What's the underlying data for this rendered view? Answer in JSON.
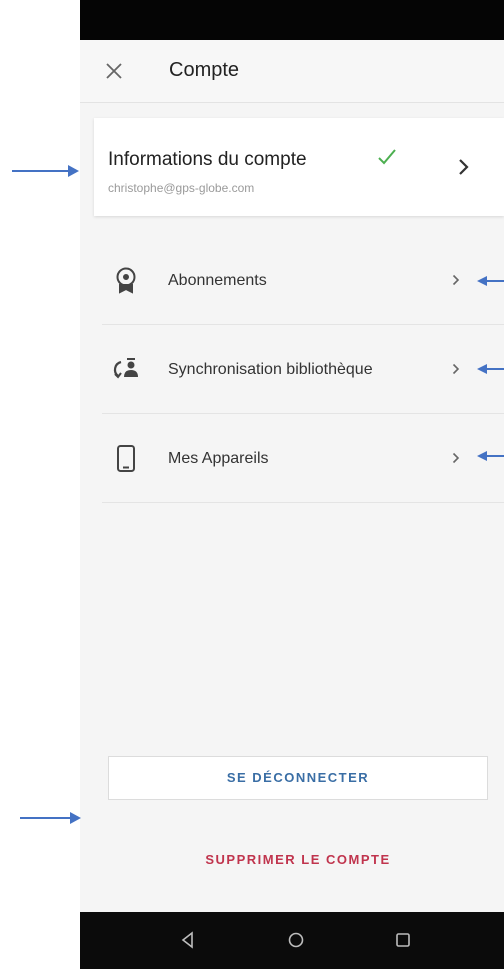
{
  "header": {
    "title": "Compte",
    "close_icon": "close-icon"
  },
  "account": {
    "title": "Informations du compte",
    "email": "christophe@gps-globe.com",
    "verified_icon": "check-icon",
    "check_color": "#4caf50"
  },
  "menu": {
    "items": [
      {
        "label": "Abonnements",
        "icon": "award-icon"
      },
      {
        "label": "Synchronisation bibliothèque",
        "icon": "sync-users-icon"
      },
      {
        "label": "Mes Appareils",
        "icon": "smartphone-icon"
      }
    ]
  },
  "actions": {
    "logout_label": "SE DÉCONNECTER",
    "delete_label": "SUPPRIMER LE COMPTE",
    "logout_color": "#3a6ea5",
    "delete_color": "#c0344d"
  },
  "nav": {
    "icons": [
      "back-triangle-icon",
      "home-circle-icon",
      "recents-square-icon"
    ]
  },
  "annotations": {
    "arrow_color": "#4472c4"
  }
}
